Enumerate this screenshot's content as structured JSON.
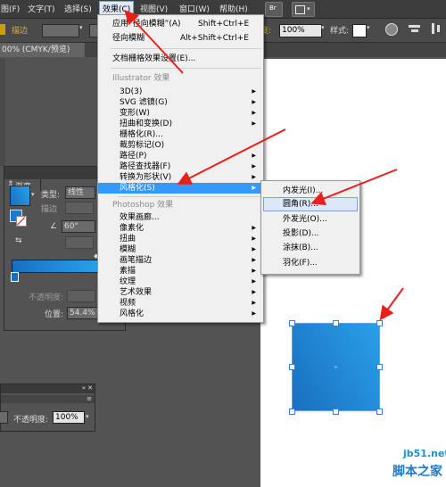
{
  "menubar": {
    "items": [
      "图(F)",
      "文字(T)",
      "选择(S)",
      "效果(C)",
      "视图(V)",
      "窗口(W)",
      "帮助(H)"
    ],
    "br_label": "Br"
  },
  "control_bar": {
    "stroke_label": "描边",
    "opacity_value": "100%",
    "style_label": "样式:",
    "opacity_label_partial": "度:"
  },
  "document_tab": {
    "title": "00% (CMYK/预览)"
  },
  "effect_menu": {
    "items": [
      {
        "label": "应用“径向模糊”(A)",
        "shortcut": "Shift+Ctrl+E"
      },
      {
        "label": "径向模糊",
        "shortcut": "Alt+Shift+Ctrl+E"
      },
      {
        "label": "文档栅格效果设置(E)..."
      }
    ],
    "illustrator_header": "Illustrator 效果",
    "illustrator_items": [
      "3D(3)",
      "SVG 滤镜(G)",
      "变形(W)",
      "扭曲和变换(D)",
      "栅格化(R)...",
      "裁剪标记(O)",
      "路径(P)",
      "路径查找器(F)",
      "转换为形状(V)",
      "风格化(S)"
    ],
    "photoshop_header": "Photoshop 效果",
    "photoshop_items": [
      "效果画廊...",
      "像素化",
      "扭曲",
      "模糊",
      "画笔描边",
      "素描",
      "纹理",
      "艺术效果",
      "视频",
      "风格化"
    ]
  },
  "stylize_submenu": {
    "items": [
      "内发光(I)...",
      "圆角(R)...",
      "外发光(O)...",
      "投影(D)...",
      "涂抹(B)...",
      "羽化(F)..."
    ],
    "highlighted_index": 1
  },
  "gradient_panel": {
    "title": "渐变",
    "type_label": "类型:",
    "type_value": "线性",
    "stroke_label": "描边",
    "angle_value": "60°",
    "opacity_label": "不透明度:",
    "position_label": "位置:",
    "position_value": "54.4%"
  },
  "bottom_panel": {
    "opacity_label": "不透明度:",
    "opacity_value": "100%"
  },
  "watermark": {
    "site": "jb51.net",
    "name": "脚本之家"
  },
  "colors": {
    "menu_highlight": "#3399ff",
    "gradient_start": "#1a6ec0",
    "gradient_end": "#2aa0e8",
    "arrow": "#e8201c"
  }
}
